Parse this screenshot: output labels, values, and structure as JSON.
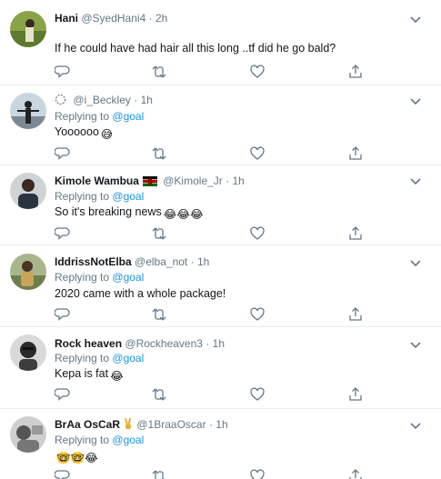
{
  "tweets": [
    {
      "name": "Hani",
      "handle": "@SyedHani4",
      "time": "2h",
      "replying_prefix": "",
      "replying_to": "",
      "text": "If he could have had hair all this long ..tf did he go bald?",
      "emojis": ""
    },
    {
      "name": "",
      "handle": "@i_Beckley",
      "time": "1h",
      "replying_prefix": "Replying to",
      "replying_to": "@goal",
      "text": "Yoooooo",
      "emojis": "😅"
    },
    {
      "name": "Kimole Wambua",
      "handle": "@Kimole_Jr",
      "time": "1h",
      "replying_prefix": "Replying to",
      "replying_to": "@goal",
      "text": "So it's breaking news",
      "emojis": "😂😂😂"
    },
    {
      "name": "IddrissNotElba",
      "handle": "@elba_not",
      "time": "1h",
      "replying_prefix": "Replying to",
      "replying_to": "@goal",
      "text": "2020 came with a whole package!",
      "emojis": ""
    },
    {
      "name": "Rock heaven",
      "handle": "@Rockheaven3",
      "time": "1h",
      "replying_prefix": "Replying to",
      "replying_to": "@goal",
      "text": "Kepa is fat",
      "emojis": "😂"
    },
    {
      "name": "BrAa OsCaR",
      "handle": "@1BraaOscar",
      "time": "1h",
      "replying_prefix": "Replying to",
      "replying_to": "@goal",
      "text": "",
      "emojis": "🤓🤓😂"
    }
  ],
  "dot": "·",
  "icons": {
    "reply": "reply-icon",
    "retweet": "retweet-icon",
    "like": "heart-icon",
    "share": "share-icon",
    "more": "chevron-down-icon"
  },
  "colors": {
    "accent": "#1b95e0",
    "muted": "#657786",
    "text": "#14171a",
    "divider": "#e6ecf0",
    "flag_green": "#006600",
    "flag_red": "#bb0000"
  }
}
